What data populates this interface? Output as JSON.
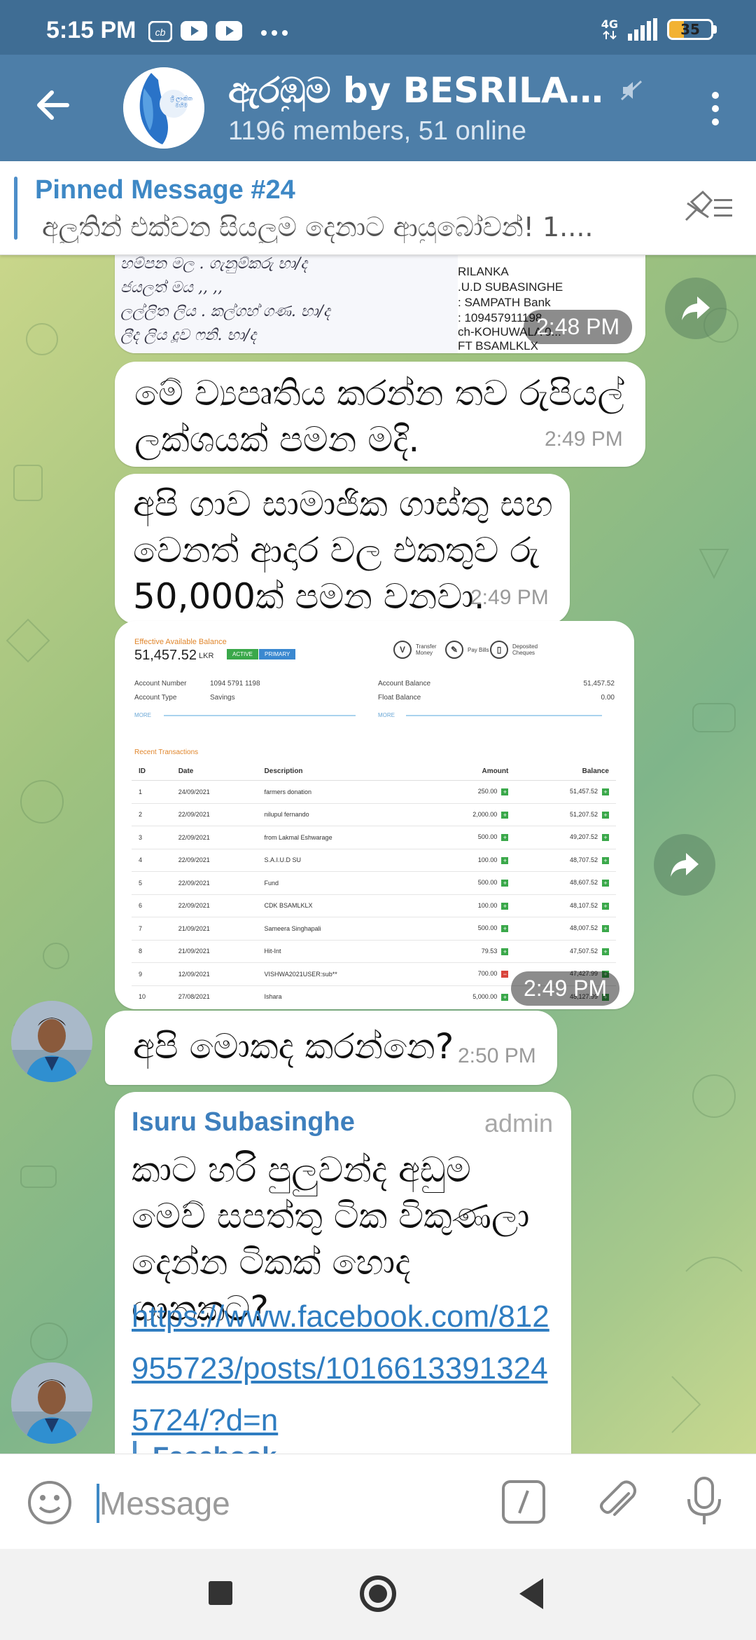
{
  "status_bar": {
    "time": "5:15 PM",
    "notification_icons": [
      "cb-icon",
      "youtube-icon",
      "youtube-icon",
      "more-dots-icon"
    ],
    "network": "4G",
    "battery": "35",
    "battery_level": 0.35
  },
  "header": {
    "title": "ඇරඹුම by BESRILANK...",
    "subtitle": "1196 members, 51 online",
    "avatar_text": "ශ්‍රී ලාංකික මහිම"
  },
  "pinned": {
    "title": "Pinned Message #24",
    "text": "අලුතින් එක්වන සියලුම දෙනාට ආයුබෝවන්!  1...."
  },
  "messages": {
    "doc_time": "2:48 PM",
    "doc_hand_lines": [
      "හම්පන   මල .    ගැනුම්කරු   භා/ද",
      "ජයලත් මය        ,,          ,,",
      "ලල්ලිත ලිය .     කල්ගහ් ගණ. භා/ද",
      "ලීද   ලිය         දූව ෆනි. භා/ද"
    ],
    "doc_bank_lines": [
      "RILANKA",
      ".U.D SUBASINGHE",
      ": SAMPATH Bank",
      ": 109457911198",
      "ch-KOHUWALA 0...",
      "FT  BSAMLKLX"
    ],
    "msg1_text": "මේ ව්‍යපෘතිය කරන්න තව රුපියල් ලක්ශයක් පමන මදි.",
    "msg1_time": "2:49 PM",
    "msg2_text": "අපි ගාව සාමාජික ගාස්තු සහ වෙනත් ආදාර වල එකතුව රු 50,000ක් පමන වනවා.",
    "msg2_time": "2:49 PM",
    "bank_time": "2:49 PM",
    "msg3_text": "අපි මොකද කරන්නෙ?",
    "msg3_time": "2:50 PM",
    "admin_sender": "Isuru Subasinghe",
    "admin_tag": "admin",
    "admin_text": "කාට හරි පුලුවන්ද අඩුම මෙව් සපත්තු ටික විකුණලා දෙන්න ටිකක් හොද ගානකට?",
    "admin_link": "https://www.facebook.com/812955723/posts/10166133913245724/?d=n",
    "preview_title": "Facebook"
  },
  "bank": {
    "eab_label": "Effective Available Balance",
    "eab_value": "51,457.52",
    "eab_ccy": "LKR",
    "badge_active": "ACTIVE",
    "badge_primary": "PRIMARY",
    "transfer": "Transfer Money",
    "pay_bills": "Pay Bills",
    "deposited": "Deposited Cheques",
    "account_number_label": "Account Number",
    "account_number": "1094 5791 1198",
    "account_type_label": "Account Type",
    "account_type": "Savings",
    "account_balance_label": "Account Balance",
    "account_balance": "51,457.52",
    "float_balance_label": "Float Balance",
    "float_balance": "0.00",
    "more": "MORE",
    "recent_title": "Recent Transactions",
    "columns": [
      "ID",
      "Date",
      "Description",
      "Amount",
      "Balance"
    ],
    "rows": [
      {
        "id": "1",
        "date": "24/09/2021",
        "desc": "farmers donation",
        "amount": "250.00",
        "balance": "51,457.52",
        "debit": false
      },
      {
        "id": "2",
        "date": "22/09/2021",
        "desc": "nilupul fernando",
        "amount": "2,000.00",
        "balance": "51,207.52",
        "debit": false
      },
      {
        "id": "3",
        "date": "22/09/2021",
        "desc": "from Lakmal Eshwarage",
        "amount": "500.00",
        "balance": "49,207.52",
        "debit": false
      },
      {
        "id": "4",
        "date": "22/09/2021",
        "desc": "S.A.I.U.D SU",
        "amount": "100.00",
        "balance": "48,707.52",
        "debit": false
      },
      {
        "id": "5",
        "date": "22/09/2021",
        "desc": "Fund",
        "amount": "500.00",
        "balance": "48,607.52",
        "debit": false
      },
      {
        "id": "6",
        "date": "22/09/2021",
        "desc": "CDK BSAMLKLX",
        "amount": "100.00",
        "balance": "48,107.52",
        "debit": false
      },
      {
        "id": "7",
        "date": "21/09/2021",
        "desc": "Sameera Singhapali",
        "amount": "500.00",
        "balance": "48,007.52",
        "debit": false
      },
      {
        "id": "8",
        "date": "21/09/2021",
        "desc": "Hit-Int",
        "amount": "79.53",
        "balance": "47,507.52",
        "debit": false
      },
      {
        "id": "9",
        "date": "12/09/2021",
        "desc": "VISHWA2021USER:sub**",
        "amount": "700.00",
        "balance": "47,427.99",
        "debit": true
      },
      {
        "id": "10",
        "date": "27/08/2021",
        "desc": "Ishara",
        "amount": "5,000.00",
        "balance": "48,127.99",
        "debit": false
      }
    ]
  },
  "input": {
    "placeholder": "Message"
  },
  "colors": {
    "header": "#4d7ea8",
    "status_bar": "#3f6d94",
    "link": "#2f7dc1",
    "accent": "#3e88c5"
  }
}
